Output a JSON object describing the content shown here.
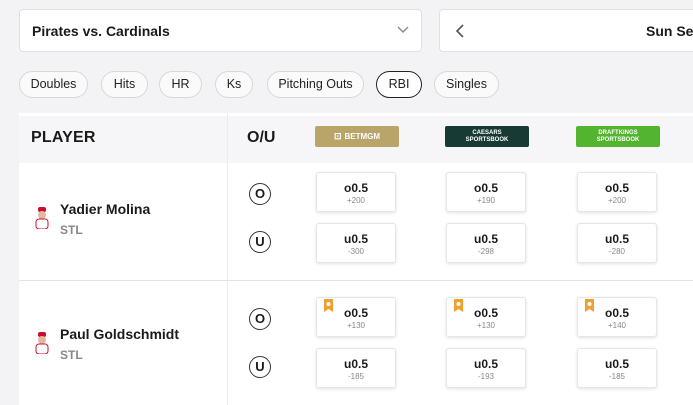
{
  "game_select": {
    "label": "Pirates vs. Cardinals"
  },
  "date_nav": {
    "label": "Sun Se"
  },
  "chips": [
    "Doubles",
    "Hits",
    "HR",
    "Ks",
    "Pitching Outs",
    "RBI",
    "Singles"
  ],
  "active_chip": "RBI",
  "table": {
    "player_header": "PLAYER",
    "ou_header": "O/U",
    "books": [
      {
        "name": "BETMGM",
        "mark": "⊡",
        "color": "#b9a46a"
      },
      {
        "name": "SPORTSBOOK",
        "mark": "CAESARS",
        "color": "#173a34"
      },
      {
        "name": "SPORTSBOOK",
        "mark": "DRAFTKINGS",
        "color": "#53b52f"
      }
    ],
    "over_label": "O",
    "under_label": "U",
    "players": [
      {
        "name": "Yadier Molina",
        "team": "STL",
        "over": [
          {
            "line": "o0.5",
            "price": "+200"
          },
          {
            "line": "o0.5",
            "price": "+190"
          },
          {
            "line": "o0.5",
            "price": "+200"
          }
        ],
        "under": [
          {
            "line": "u0.5",
            "price": "-300"
          },
          {
            "line": "u0.5",
            "price": "-298"
          },
          {
            "line": "u0.5",
            "price": "-280"
          }
        ]
      },
      {
        "name": "Paul Goldschmidt",
        "team": "STL",
        "over": [
          {
            "line": "o0.5",
            "price": "+130",
            "boost": true
          },
          {
            "line": "o0.5",
            "price": "+130",
            "boost": true
          },
          {
            "line": "o0.5",
            "price": "+140",
            "boost": true
          }
        ],
        "under": [
          {
            "line": "u0.5",
            "price": "-185"
          },
          {
            "line": "u0.5",
            "price": "-193"
          },
          {
            "line": "u0.5",
            "price": "-185"
          }
        ]
      }
    ]
  }
}
